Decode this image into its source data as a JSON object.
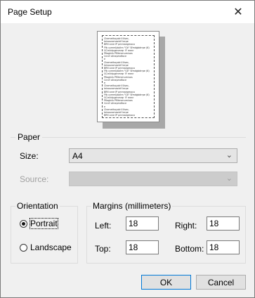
{
  "window": {
    "title": "Page Setup",
    "close_glyph": "✕"
  },
  "preview": {
    "lines": [
      "Chemethoyatril Ilisec,",
      "Ieinouromaxtrif lerpe",
      "BRfi anre IP pmmaegmoco",
      "Ffb cymmljdoitm \"Gk\" Sfmdgbdrrpe (6)",
      "GCmintpgenmrqr !F menr",
      "PKoglsfu Pflitmenumiuos",
      "Cnnif ollnepmdfoce",
      "e",
      "Chemethoyatril Ilisec,",
      "Ieinouromaxtrif lerpe",
      "BRfi anre IP pmmaegmoco",
      "Ffb cymmljdoitm \"Gk\" Sfmdgbdrrpe (6)",
      "GCmintpgenmrqr !F menr",
      "PKoglsfu Pflitmenumiuos",
      "Cnnif ollnepmdfoce",
      "e",
      "Chemethoyatril Ilisec,",
      "Ieinouromaxtrif lerpe",
      "BRfi anre IP pmmaegmoco",
      "Ffb cymmljdoitm \"Gk\" Sfmdgbdrrpe (6)",
      "GCmintpgenmrqr !F menr",
      "PKoglsfu Pflitmenumiuos",
      "Cnnif ollnepmdfoce",
      "e",
      "Chemethoyatril Ilisec,",
      "Ieinouromaxtrif lerpe",
      "BRfi anre IP pmmaegmoco"
    ]
  },
  "paper": {
    "group_label": "Paper",
    "size_label": "Size:",
    "size_value": "A4",
    "source_label": "Source:",
    "source_value": ""
  },
  "orientation": {
    "group_label": "Orientation",
    "portrait_label": "Portrait",
    "landscape_label": "Landscape",
    "selected": "Portrait"
  },
  "margins": {
    "group_label": "Margins (millimeters)",
    "left_label": "Left:",
    "left_value": "18",
    "right_label": "Right:",
    "right_value": "18",
    "top_label": "Top:",
    "top_value": "18",
    "bottom_label": "Bottom:",
    "bottom_value": "18"
  },
  "buttons": {
    "ok_label": "OK",
    "cancel_label": "Cancel"
  },
  "colors": {
    "background": "#f0f0f0",
    "titlebar": "#ffffff",
    "default_button_border": "#0078d7"
  }
}
